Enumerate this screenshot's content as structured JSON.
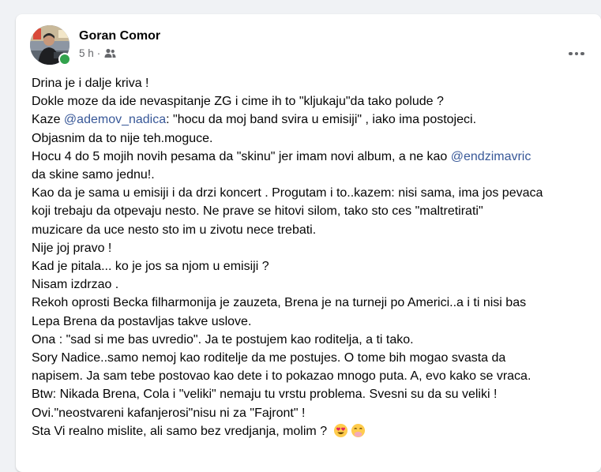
{
  "post": {
    "author": "Goran Comor",
    "time": "5 h",
    "separator": "·",
    "audience_icon": "friends-icon",
    "more_icon": "more-options-icon",
    "lines": [
      {
        "parts": [
          {
            "text": "Drina je i dalje kriva !"
          }
        ]
      },
      {
        "parts": [
          {
            "text": "Dokle moze da ide nevaspitanje ZG i cime ih to \"kljukaju\"da tako polude ?"
          }
        ]
      },
      {
        "parts": [
          {
            "text": "Kaze "
          },
          {
            "text": "@ademov_nadica",
            "mention": true
          },
          {
            "text": ":  \"hocu da moj band svira u emisiji\" , iako ima postojeci."
          }
        ]
      },
      {
        "parts": [
          {
            "text": "Objasnim da to nije teh.moguce."
          }
        ]
      },
      {
        "parts": [
          {
            "text": "Hocu 4 do 5 mojih novih pesama da \"skinu\" jer imam novi album, a ne kao "
          },
          {
            "text": "@endzimavric",
            "mention": true
          }
        ]
      },
      {
        "parts": [
          {
            "text": "da skine samo jednu!."
          }
        ]
      },
      {
        "parts": [
          {
            "text": "Kao da je sama u emisiji i da drzi koncert . Progutam i to..kazem: nisi sama, ima jos pevaca"
          }
        ]
      },
      {
        "parts": [
          {
            "text": "koji trebaju da otpevaju nesto. Ne prave se hitovi silom, tako sto ces \"maltretirati\""
          }
        ]
      },
      {
        "parts": [
          {
            "text": "muzicare da uce nesto sto im u zivotu nece trebati."
          }
        ]
      },
      {
        "parts": [
          {
            "text": "Nije joj pravo !"
          }
        ]
      },
      {
        "parts": [
          {
            "text": "Kad je pitala... ko je jos sa njom u emisiji ?"
          }
        ]
      },
      {
        "parts": [
          {
            "text": "Nisam izdrzao ."
          }
        ]
      },
      {
        "parts": [
          {
            "text": "Rekoh oprosti Becka filharmonija je zauzeta, Brena je na turneji po Americi..a i ti nisi bas"
          }
        ]
      },
      {
        "parts": [
          {
            "text": "Lepa Brena da postavljas takve uslove."
          }
        ]
      },
      {
        "parts": [
          {
            "text": "Ona : \"sad si me bas uvredio\". Ja te postujem kao roditelja, a ti tako."
          }
        ]
      },
      {
        "parts": [
          {
            "text": "Sory Nadice..samo nemoj kao roditelje da me postujes. O tome bih mogao svasta da"
          }
        ]
      },
      {
        "parts": [
          {
            "text": "napisem. Ja sam tebe postovao kao dete i to pokazao mnogo puta. A, evo kako se vraca."
          }
        ]
      },
      {
        "parts": [
          {
            "text": "Btw: Nikada Brena, Cola i \"veliki\" nemaju tu vrstu problema. Svesni su da su veliki !"
          }
        ]
      },
      {
        "parts": [
          {
            "text": "Ovi.\"neostvareni kafanjerosi\"nisu ni za \"Fajront\" !"
          }
        ]
      },
      {
        "parts": [
          {
            "text": "Sta Vi realno mislite, ali samo bez vredjanja, molim ? "
          }
        ],
        "emojis": [
          "heart-eyes-emoji",
          "hand-over-mouth-emoji"
        ]
      }
    ]
  },
  "colors": {
    "page_bg": "#f0f2f5",
    "card_bg": "#ffffff",
    "text": "#050505",
    "secondary_text": "#65676b",
    "mention": "#385898",
    "online": "#31a24c"
  }
}
